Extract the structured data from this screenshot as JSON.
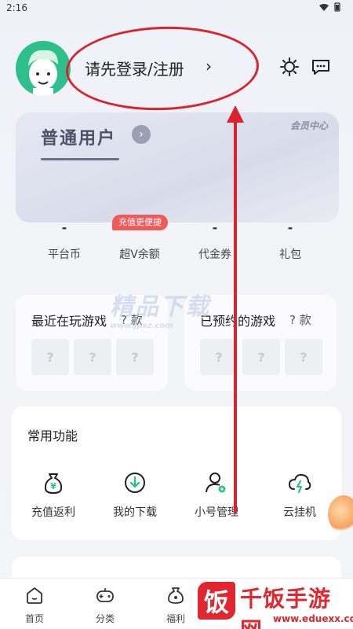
{
  "status_bar": {
    "time": "2:16"
  },
  "header": {
    "login_text": "请先登录/注册",
    "chevron": "›",
    "icons": [
      "settings-icon",
      "message-icon"
    ]
  },
  "vip": {
    "title": "普通用户",
    "badge": "›",
    "center_label": "会员中心"
  },
  "recharge_tag": "充值更便捷",
  "stats": [
    {
      "value": "-",
      "label": "平台币"
    },
    {
      "value": "-",
      "label": "超V余额"
    },
    {
      "value": "-",
      "label": "代金券"
    },
    {
      "value": "-",
      "label": "礼包"
    }
  ],
  "watermark": {
    "text": "精品下载",
    "sub": "www.jpxz.com"
  },
  "games": {
    "recent": {
      "title": "最近在玩游戏",
      "count": "? 款",
      "slot": "?"
    },
    "reserved": {
      "title": "已预约的游戏",
      "count": "? 款",
      "slot": "?"
    }
  },
  "functions": {
    "title": "常用功能",
    "items": [
      {
        "label": "充值返利",
        "icon": "money-bag-icon"
      },
      {
        "label": "我的下载",
        "icon": "download-icon"
      },
      {
        "label": "小号管理",
        "icon": "user-settings-icon"
      },
      {
        "label": "云挂机",
        "icon": "cloud-icon"
      }
    ]
  },
  "bottom_nav": [
    {
      "label": "首页",
      "icon": "home-icon"
    },
    {
      "label": "分类",
      "icon": "gamepad-icon"
    },
    {
      "label": "福利",
      "icon": "bag-icon"
    }
  ],
  "brand": {
    "name": "千饭手游网",
    "logo_char": "饭",
    "url": "www.eduexx.com"
  },
  "colors": {
    "accent_red": "#d9232d",
    "green": "#2fbf8c",
    "card_bg": "#ffffff"
  }
}
